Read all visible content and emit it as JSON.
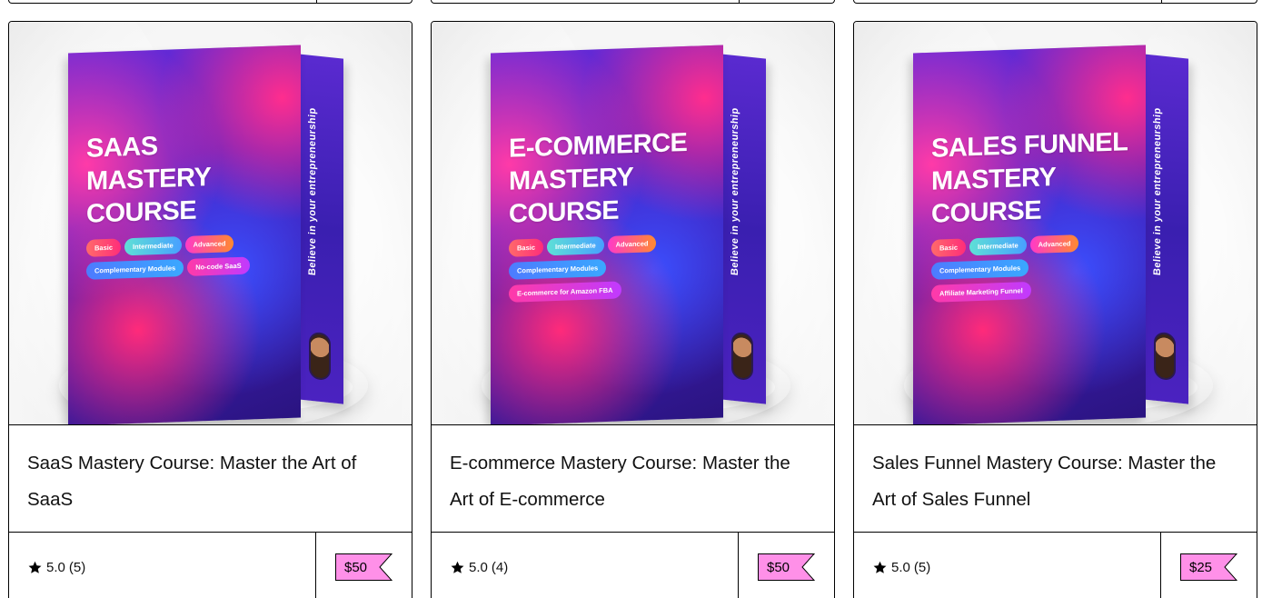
{
  "cards": [
    {
      "product_name": "SaaS Mastery Course: Master the Art of SaaS",
      "cover": {
        "title_lines": [
          "SAAS",
          "MASTERY",
          "COURSE"
        ],
        "pills": [
          "Basic",
          "Intermediate",
          "Advanced",
          "Complementary Modules",
          "No-code SaaS"
        ],
        "side_text": "Believe in your entrepreneurship"
      },
      "rating_value": "5.0",
      "rating_count": "(5)",
      "price": "$50"
    },
    {
      "product_name": "E-commerce Mastery Course: Master the Art of E-commerce",
      "cover": {
        "title_lines": [
          "E-COMMERCE",
          "MASTERY",
          "COURSE"
        ],
        "pills": [
          "Basic",
          "Intermediate",
          "Advanced",
          "Complementary Modules",
          "E-commerce for Amazon FBA"
        ],
        "side_text": "Believe in your entrepreneurship"
      },
      "rating_value": "5.0",
      "rating_count": "(4)",
      "price": "$50"
    },
    {
      "product_name": "Sales Funnel Mastery Course: Master the Art of Sales Funnel",
      "cover": {
        "title_lines": [
          "SALES FUNNEL",
          "MASTERY",
          "COURSE"
        ],
        "pills": [
          "Basic",
          "Intermediate",
          "Advanced",
          "Complementary Modules",
          "Affiliate Marketing Funnel"
        ],
        "side_text": "Believe in your entrepreneurship"
      },
      "rating_value": "5.0",
      "rating_count": "(5)",
      "price": "$25"
    }
  ],
  "colors": {
    "price_tag": "#ff90e8",
    "border": "#000000",
    "cover_purple": "#4a22c8",
    "cover_pink": "#ff2d8e"
  },
  "icons": {
    "rating": "star-icon"
  }
}
